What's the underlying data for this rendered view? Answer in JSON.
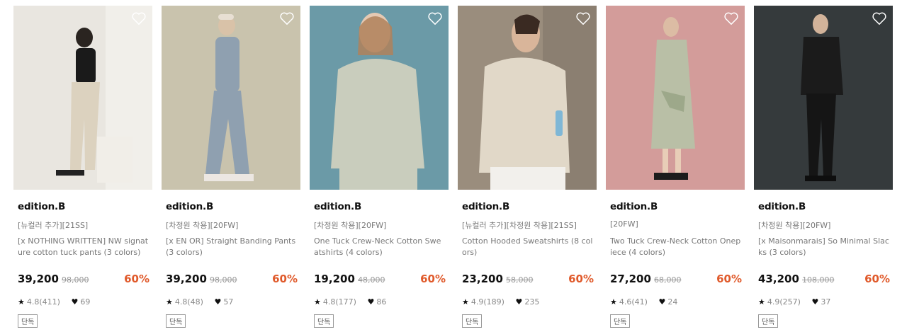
{
  "products": [
    {
      "brand": "edition.B",
      "tag": "[뉴컬러 추가][21SS]",
      "name": "[x NOTHING WRITTEN] NW signature cotton tuck pants (3 colors)",
      "price": "39,200",
      "original_price": "98,000",
      "discount": "60%",
      "rating": "4.8(411)",
      "likes": "69",
      "badge": "단독",
      "bg_color": "#e9e6e0",
      "figure_top": "#1a1a1a",
      "figure_bottom": "#dcd2bf"
    },
    {
      "brand": "edition.B",
      "tag": "[차정원 착용][20FW]",
      "name": "[x EN OR] Straight Banding Pants (3 colors)",
      "price": "39,200",
      "original_price": "98,000",
      "discount": "60%",
      "rating": "4.8(48)",
      "likes": "57",
      "badge": "단독",
      "bg_color": "#c9c3ad",
      "figure_top": "#8fa0b0",
      "figure_bottom": "#8fa0b0"
    },
    {
      "brand": "edition.B",
      "tag": "[차정원 착용][20FW]",
      "name": "One Tuck Crew-Neck Cotton Sweatshirts (4 colors)",
      "price": "19,200",
      "original_price": "48,000",
      "discount": "60%",
      "rating": "4.8(177)",
      "likes": "86",
      "badge": "단독",
      "bg_color": "#6b9aa7",
      "figure_top": "#c9cdbd",
      "figure_bottom": "#c9cdbd"
    },
    {
      "brand": "edition.B",
      "tag": "[뉴컬러 추가][차정원 착용][21SS]",
      "name": "Cotton Hooded Sweatshirts (8 colors)",
      "price": "23,200",
      "original_price": "58,000",
      "discount": "60%",
      "rating": "4.9(189)",
      "likes": "235",
      "badge": "단독",
      "bg_color": "#9a8d7d",
      "figure_top": "#e1d8c8",
      "figure_bottom": "#f2f0ec"
    },
    {
      "brand": "edition.B",
      "tag": "[20FW]",
      "name": "Two Tuck Crew-Neck Cotton Onepiece (4 colors)",
      "price": "27,200",
      "original_price": "68,000",
      "discount": "60%",
      "rating": "4.6(41)",
      "likes": "24",
      "badge": "단독",
      "bg_color": "#d39c9a",
      "figure_top": "#b9bfa6",
      "figure_bottom": "#b9bfa6"
    },
    {
      "brand": "edition.B",
      "tag": "[차정원 착용][20FW]",
      "name": "[x Maisonmarais] So Minimal Slacks (3 colors)",
      "price": "43,200",
      "original_price": "108,000",
      "discount": "60%",
      "rating": "4.9(257)",
      "likes": "37",
      "badge": "단독",
      "bg_color": "#353a3c",
      "figure_top": "#1b1b1b",
      "figure_bottom": "#151515"
    }
  ],
  "icons": {
    "wishlist": "heart-outline-icon",
    "rating": "star-icon",
    "likes": "heart-filled-icon"
  },
  "colors": {
    "discount": "#e05a2b",
    "brand_text": "#111111",
    "muted_text": "#777777"
  }
}
